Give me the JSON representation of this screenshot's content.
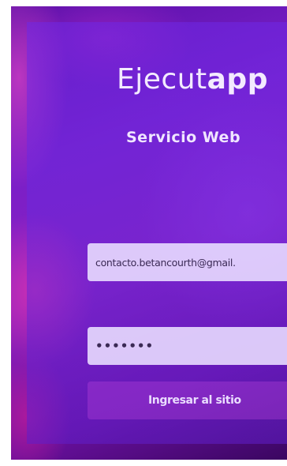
{
  "brand": {
    "prefix": "Ejecut",
    "suffix": "app"
  },
  "subtitle": "Servicio Web",
  "login": {
    "email_value": "contacto.betancourth@gmail.",
    "password_mask": "•••••••",
    "submit_label": "Ingresar al sitio"
  },
  "colors": {
    "background": "#7a1fc8",
    "input": "#e8dcff",
    "text": "#f3eaff"
  }
}
